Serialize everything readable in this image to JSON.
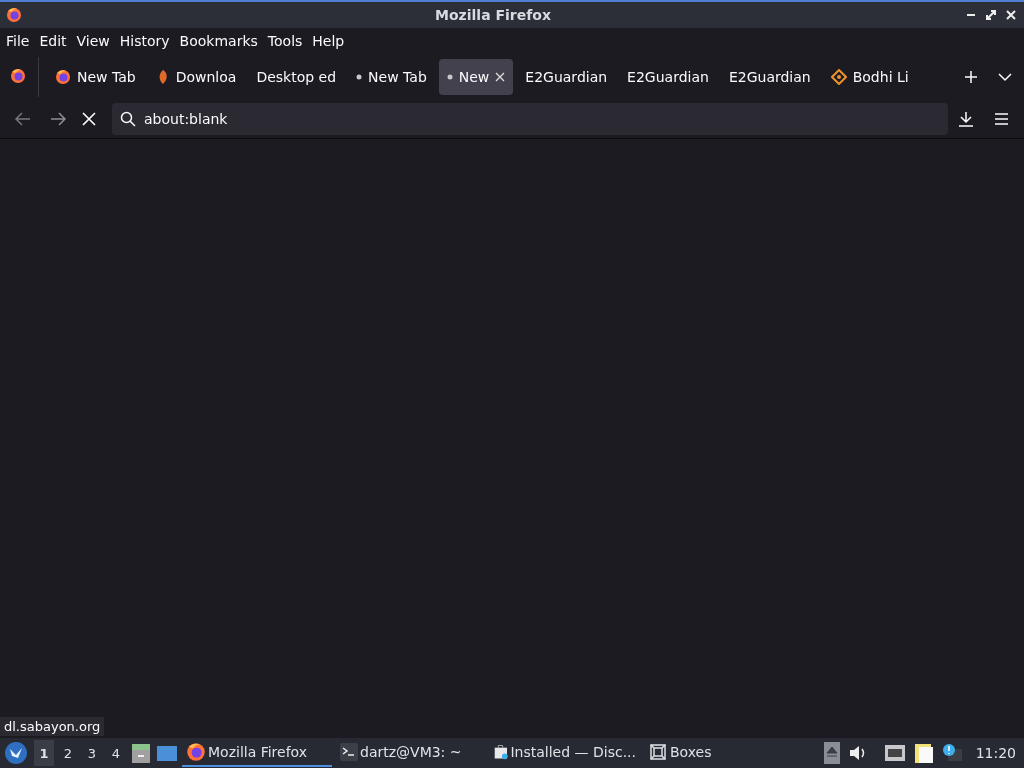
{
  "window": {
    "title": "Mozilla Firefox"
  },
  "menu": [
    "File",
    "Edit",
    "View",
    "History",
    "Bookmarks",
    "Tools",
    "Help"
  ],
  "tabs": [
    {
      "label": "New Tab",
      "kind": "firefox",
      "selected": false
    },
    {
      "label": "Downloa",
      "kind": "sabayon",
      "selected": false
    },
    {
      "label": "Desktop ed",
      "kind": "plain",
      "selected": false
    },
    {
      "label": "New Tab",
      "kind": "dot",
      "selected": false
    },
    {
      "label": "New",
      "kind": "dot",
      "selected": true
    },
    {
      "label": "E2Guardian",
      "kind": "plain",
      "selected": false
    },
    {
      "label": "E2Guardian",
      "kind": "plain",
      "selected": false
    },
    {
      "label": "E2Guardian",
      "kind": "plain",
      "selected": false
    },
    {
      "label": "Bodhi Li",
      "kind": "bodhi",
      "selected": false
    }
  ],
  "address": {
    "value": "about:blank"
  },
  "status_text": "dl.sabayon.org",
  "taskbar": {
    "workspaces": [
      {
        "label": "1",
        "selected": true
      },
      {
        "label": "2",
        "selected": false
      },
      {
        "label": "3",
        "selected": false
      },
      {
        "label": "4",
        "selected": false
      }
    ],
    "tasks": [
      {
        "label": "Mozilla Firefox",
        "kind": "firefox",
        "selected": true
      },
      {
        "label": "dartz@VM3: ~",
        "kind": "terminal",
        "selected": false
      },
      {
        "label": "Installed — Disc...",
        "kind": "store",
        "selected": false
      },
      {
        "label": "Boxes",
        "kind": "boxes",
        "selected": false
      }
    ],
    "clock": "11:20"
  }
}
